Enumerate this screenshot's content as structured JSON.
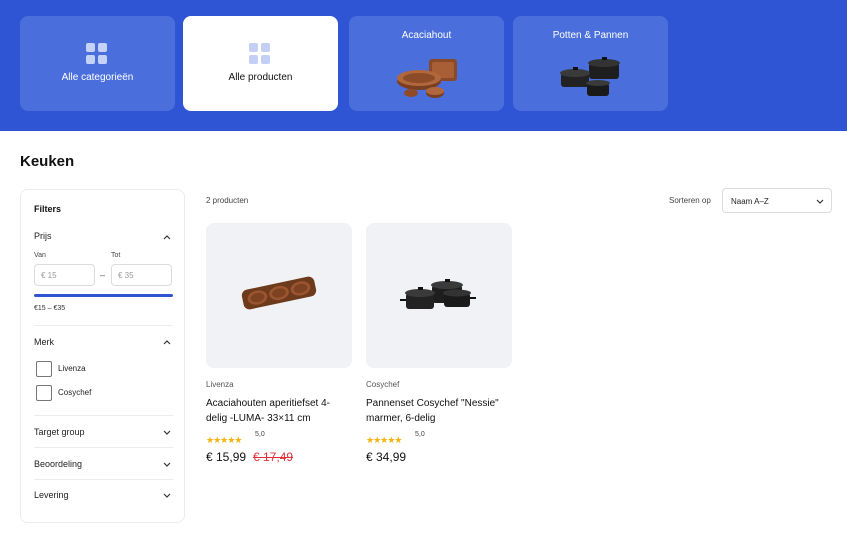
{
  "categories": [
    {
      "label": "Alle categorieën",
      "active": false,
      "icon": "grid-icon"
    },
    {
      "label": "Alle producten",
      "active": true,
      "icon": "grid-icon"
    },
    {
      "label": "Acaciahout",
      "active": false,
      "icon": "wooden-bowls-image"
    },
    {
      "label": "Potten & Pannen",
      "active": false,
      "icon": "cookware-set-image"
    }
  ],
  "page_title": "Keuken",
  "filters": {
    "title": "Filters",
    "price": {
      "title": "Prijs",
      "from_label": "Van",
      "to_label": "Tot",
      "from_placeholder": "€ 15",
      "to_placeholder": "€ 35",
      "separator": "–",
      "range_text": "€15 – €35"
    },
    "brand": {
      "title": "Merk",
      "options": [
        {
          "label": "Livenza",
          "checked": false
        },
        {
          "label": "Cosychef",
          "checked": false
        }
      ]
    },
    "collapsed_sections": [
      "Target group",
      "Beoordeling",
      "Levering"
    ]
  },
  "results": {
    "count_text": "2 producten",
    "sort_label": "Sorteren op",
    "sort_value": "Naam A–Z"
  },
  "products": [
    {
      "brand": "Livenza",
      "name": "Acaciahouten aperitiefset 4-delig -LUMA- 33×11 cm",
      "rating": "5,0",
      "stars": 5,
      "price": "€ 15,99",
      "old_price": "€ 17,49",
      "image": "wooden-serving-tray-image"
    },
    {
      "brand": "Cosychef",
      "name": "Pannenset Cosychef \"Nessie\" marmer, 6-delig",
      "rating": "5,0",
      "stars": 5,
      "price": "€ 34,99",
      "old_price": "",
      "image": "black-pan-set-image"
    }
  ],
  "colors": {
    "brand_blue": "#2f55d4",
    "tile_blue": "#4a6fdc",
    "star_yellow": "#f5b20a",
    "sale_red": "#e0303a"
  }
}
